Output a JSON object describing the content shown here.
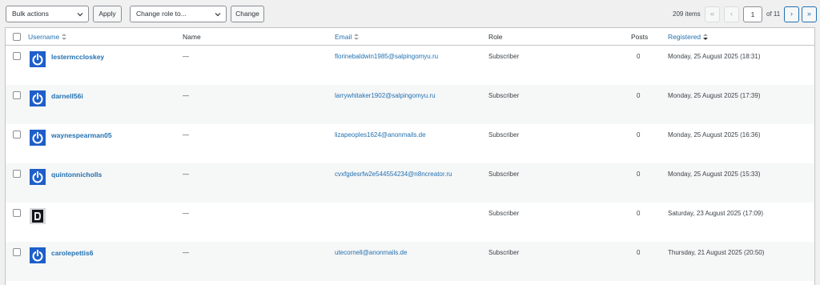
{
  "toolbar": {
    "bulk_actions": "Bulk actions",
    "apply": "Apply",
    "change_role": "Change role to...",
    "change": "Change"
  },
  "pagination": {
    "items_count": "209 items",
    "first": "«",
    "prev": "‹",
    "current_page": "1",
    "of_pages": "of 11",
    "next": "›",
    "last": "»"
  },
  "columns": {
    "username": "Username",
    "name": "Name",
    "email": "Email",
    "role": "Role",
    "posts": "Posts",
    "registered": "Registered"
  },
  "users": [
    {
      "username": "lestermccloskey",
      "name": "—",
      "email": "florinebaldwin1985@salpingomyu.ru",
      "role": "Subscriber",
      "posts": "0",
      "registered": "Monday, 25 August 2025 (18:31)",
      "avatar": "power-icon"
    },
    {
      "username": "darnell56i",
      "name": "—",
      "email": "larrywhitaker1902@salpingomyu.ru",
      "role": "Subscriber",
      "posts": "0",
      "registered": "Monday, 25 August 2025 (17:39)",
      "avatar": "power-icon"
    },
    {
      "username": "waynespearman05",
      "name": "—",
      "email": "lizapeoples1624@anonmails.de",
      "role": "Subscriber",
      "posts": "0",
      "registered": "Monday, 25 August 2025 (16:36)",
      "avatar": "power-icon"
    },
    {
      "username": "quintonnicholls",
      "name": "—",
      "email": "cvxfgdesrfw2e544554234@n8ncreator.ru",
      "role": "Subscriber",
      "posts": "0",
      "registered": "Monday, 25 August 2025 (15:33)",
      "avatar": "power-icon"
    },
    {
      "username": "",
      "name": "—",
      "email": "",
      "role": "Subscriber",
      "posts": "0",
      "registered": "Saturday, 23 August 2025 (17:09)",
      "avatar": "dark-image-icon"
    },
    {
      "username": "carolepettis6",
      "name": "—",
      "email": "utecornell@anonmails.de",
      "role": "Subscriber",
      "posts": "0",
      "registered": "Thursday, 21 August 2025 (20:50)",
      "avatar": "power-icon"
    }
  ],
  "colors": {
    "link": "#2271b1",
    "avatar_blue": "#1e5fc9",
    "background": "#f0f0f1"
  }
}
